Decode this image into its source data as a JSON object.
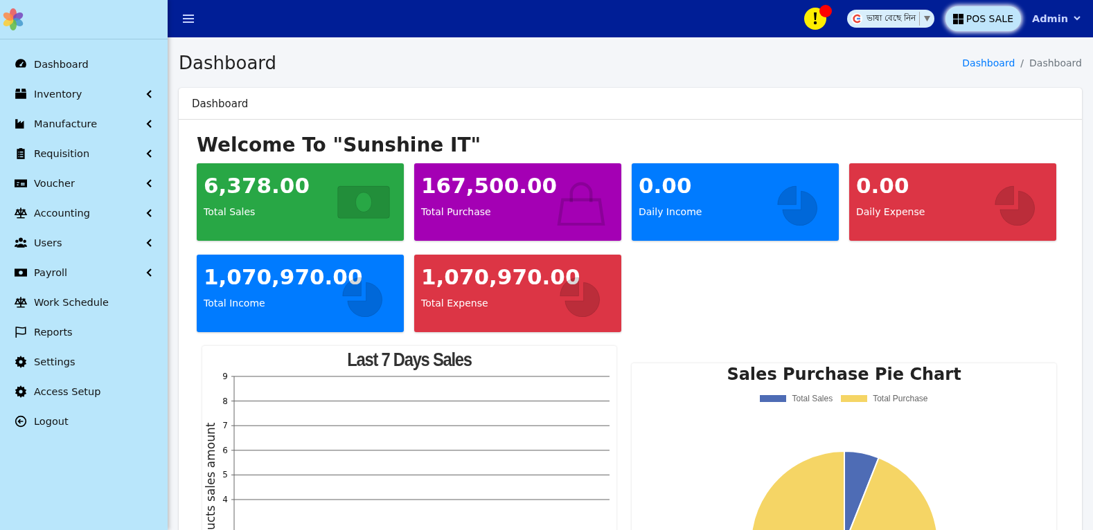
{
  "topbar": {
    "notification": {
      "has_alert": true
    },
    "translate": {
      "label": "ভাষা বেছে নিন"
    },
    "pos_button": "POS SALE",
    "user": "Admin"
  },
  "sidebar": {
    "items": [
      {
        "label": "Dashboard",
        "has_submenu": false
      },
      {
        "label": "Inventory",
        "has_submenu": true
      },
      {
        "label": "Manufacture",
        "has_submenu": true
      },
      {
        "label": "Requisition",
        "has_submenu": true
      },
      {
        "label": "Voucher",
        "has_submenu": true
      },
      {
        "label": "Accounting",
        "has_submenu": true
      },
      {
        "label": "Users",
        "has_submenu": true
      },
      {
        "label": "Payroll",
        "has_submenu": true
      },
      {
        "label": "Work Schedule",
        "has_submenu": false
      },
      {
        "label": "Reports",
        "has_submenu": false
      },
      {
        "label": "Settings",
        "has_submenu": false
      },
      {
        "label": "Access Setup",
        "has_submenu": false
      },
      {
        "label": "Logout",
        "has_submenu": false
      }
    ]
  },
  "page": {
    "title": "Dashboard",
    "breadcrumb": [
      "Dashboard",
      "Dashboard"
    ],
    "breadcrumb_separator": "/"
  },
  "panel": {
    "header": "Dashboard",
    "welcome": "Welcome To \"Sunshine IT\"",
    "stats": [
      {
        "value": "6,378.00",
        "label": "Total Sales",
        "color": "#28a745"
      },
      {
        "value": "167,500.00",
        "label": "Total Purchase",
        "color": "#a400b4"
      },
      {
        "value": "0.00",
        "label": "Daily Income",
        "color": "#007bff"
      },
      {
        "value": "0.00",
        "label": "Daily Expense",
        "color": "#dc3545"
      },
      {
        "value": "1,070,970.00",
        "label": "Total Income",
        "color": "#007bff"
      },
      {
        "value": "1,070,970.00",
        "label": "Total Expense",
        "color": "#dc3545"
      }
    ],
    "line_chart": {
      "title": "Last 7 Days Sales",
      "ylabel": "ucts sales amount",
      "y_axis_labels": [
        "9",
        "8",
        "7",
        "6",
        "5",
        "4"
      ]
    },
    "pie_chart": {
      "chart_data": {
        "type": "pie",
        "title": "Sales Purchase Pie Chart",
        "categories": [
          "Total Sales",
          "Total Purchase"
        ],
        "values": [
          6,
          94
        ],
        "colors": [
          "#4e6cb5",
          "#f5d565"
        ],
        "legend": "top"
      }
    }
  }
}
